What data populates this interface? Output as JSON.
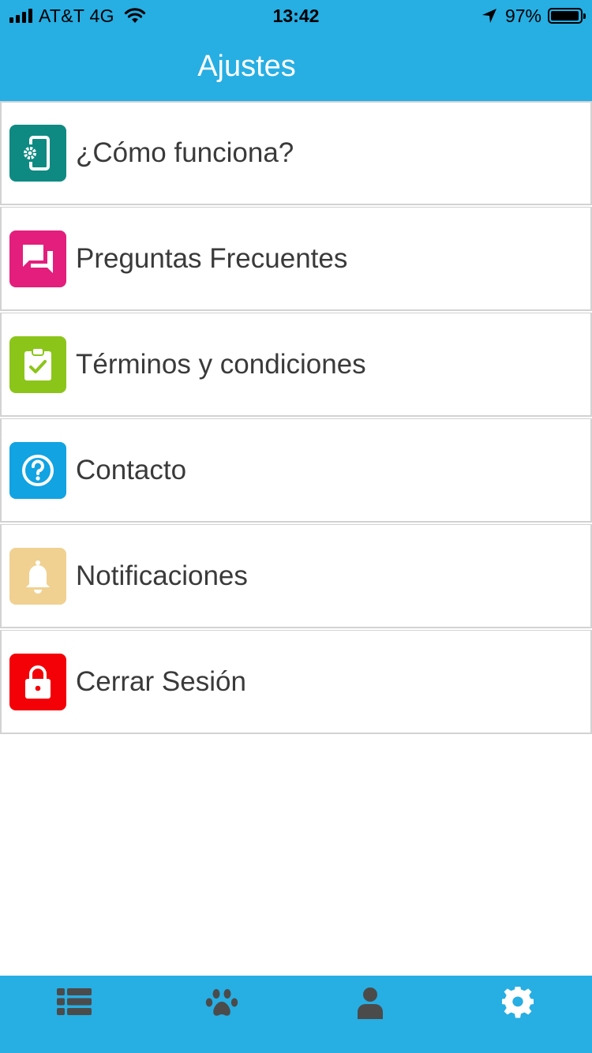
{
  "status_bar": {
    "carrier": "AT&T 4G",
    "time": "13:42",
    "battery": "97%",
    "battery_level": 0.97
  },
  "header": {
    "title": "Ajustes"
  },
  "menu": [
    {
      "label": "¿Cómo funciona?",
      "icon": "phone-settings-icon",
      "color": "#0e8a83"
    },
    {
      "label": "Preguntas Frecuentes",
      "icon": "chat-bubbles-icon",
      "color": "#e31e7c"
    },
    {
      "label": "Términos y condiciones",
      "icon": "clipboard-check-icon",
      "color": "#8cc51a"
    },
    {
      "label": "Contacto",
      "icon": "help-circle-icon",
      "color": "#11a3e2"
    },
    {
      "label": "Notificaciones",
      "icon": "bell-icon",
      "color": "#f0d192"
    },
    {
      "label": "Cerrar Sesión",
      "icon": "lock-icon",
      "color": "#f40007"
    }
  ],
  "tab_bar": {
    "tabs": [
      {
        "icon": "list-icon",
        "active": false
      },
      {
        "icon": "paw-icon",
        "active": false
      },
      {
        "icon": "user-icon",
        "active": false
      },
      {
        "icon": "gear-icon",
        "active": true
      }
    ],
    "inactive_color": "#4b4b4b",
    "active_color": "#ffffff"
  },
  "colors": {
    "brand": "#27aee3",
    "text": "#3a3a3a",
    "divider": "#d2d2d2"
  }
}
